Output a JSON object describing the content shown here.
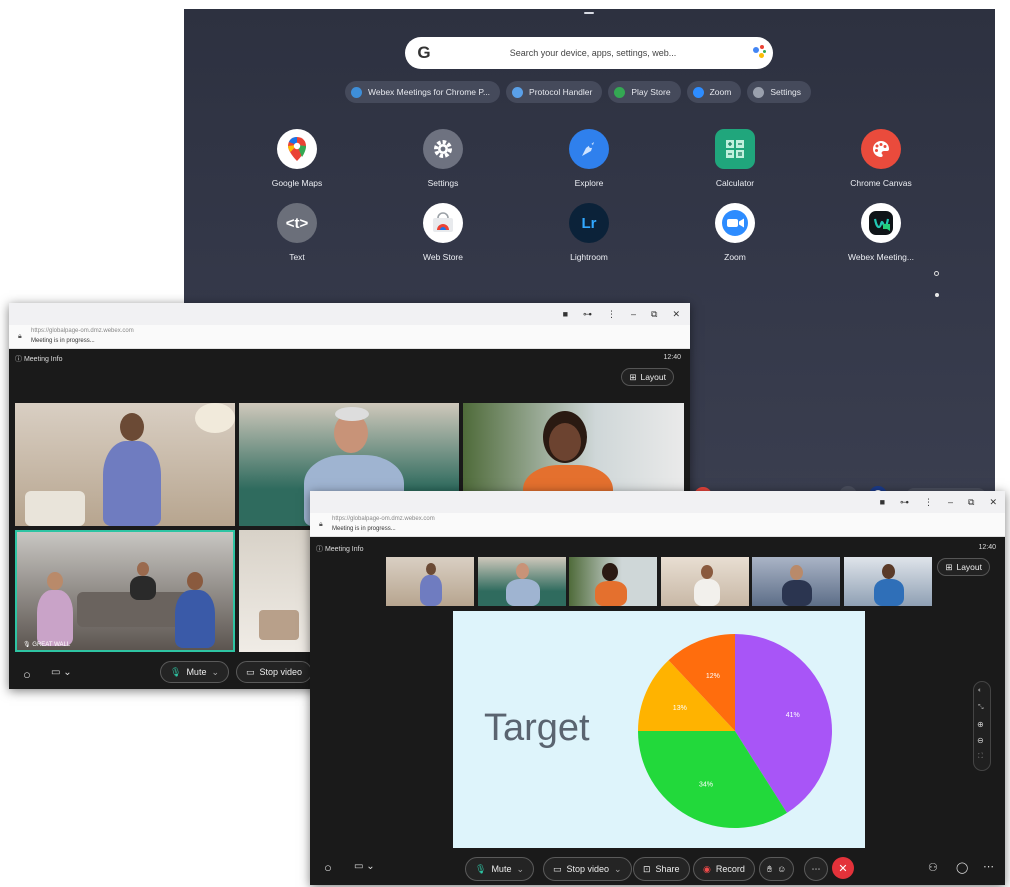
{
  "launcher": {
    "search_placeholder": "Search your device, apps, settings, web...",
    "google_letter": "G",
    "chips": [
      {
        "label": "Webex Meetings for Chrome P...",
        "icon": "webex-icon",
        "color": "#3e8ed8"
      },
      {
        "label": "Protocol Handler",
        "icon": "protocol-handler-icon",
        "color": "#5aa0e8"
      },
      {
        "label": "Play Store",
        "icon": "play-store-icon",
        "color": "#34a853"
      },
      {
        "label": "Zoom",
        "icon": "zoom-icon",
        "color": "#2d8cff"
      },
      {
        "label": "Settings",
        "icon": "gear-icon",
        "color": "#9aa0ad"
      }
    ],
    "apps": [
      {
        "label": "Google Maps",
        "icon": "google-maps-icon",
        "color": "#ffffff"
      },
      {
        "label": "Settings",
        "icon": "gear-icon",
        "color": "#6e7280"
      },
      {
        "label": "Explore",
        "icon": "explore-icon",
        "color": "#2f80ed"
      },
      {
        "label": "Calculator",
        "icon": "calculator-icon",
        "color": "#20a67c"
      },
      {
        "label": "Chrome Canvas",
        "icon": "chrome-canvas-icon",
        "color": "#ea4b3c"
      },
      {
        "label": "Text",
        "icon": "text-icon",
        "color": "#6b6f7a",
        "glyph": "<t>"
      },
      {
        "label": "Web Store",
        "icon": "web-store-icon",
        "color": "#ffffff"
      },
      {
        "label": "Lightroom",
        "icon": "lightroom-icon",
        "color": "#0b2239",
        "glyph": "Lr"
      },
      {
        "label": "Zoom",
        "icon": "zoom-icon",
        "color": "#ffffff"
      },
      {
        "label": "Webex Meeting...",
        "icon": "webex-icon",
        "color": "#ffffff"
      }
    ]
  },
  "window_back": {
    "url": "https://globalpage-om.dmz.webex.com",
    "status": "Meeting is in progress...",
    "meeting_info": "Meeting Info",
    "time": "12:40",
    "layout_label": "Layout",
    "tile_label": "GREAT WALL",
    "mute_label": "Mute",
    "stop_video_label": "Stop video"
  },
  "window_front": {
    "url": "https://globalpage-om.dmz.webex.com",
    "status": "Meeting is in progress...",
    "meeting_info": "Meeting Info",
    "time": "12:40",
    "layout_label": "Layout",
    "slide_title": "Target",
    "toolbar": {
      "mute": "Mute",
      "stop_video": "Stop video",
      "share": "Share",
      "record": "Record"
    }
  },
  "chart_data": {
    "type": "pie",
    "values": [
      41,
      34,
      13,
      12
    ],
    "labels": [
      "41%",
      "34%",
      "13%",
      "12%"
    ],
    "colors": [
      "#a855f7",
      "#22d93b",
      "#ffb300",
      "#ff6d0d"
    ],
    "title": "Target"
  }
}
